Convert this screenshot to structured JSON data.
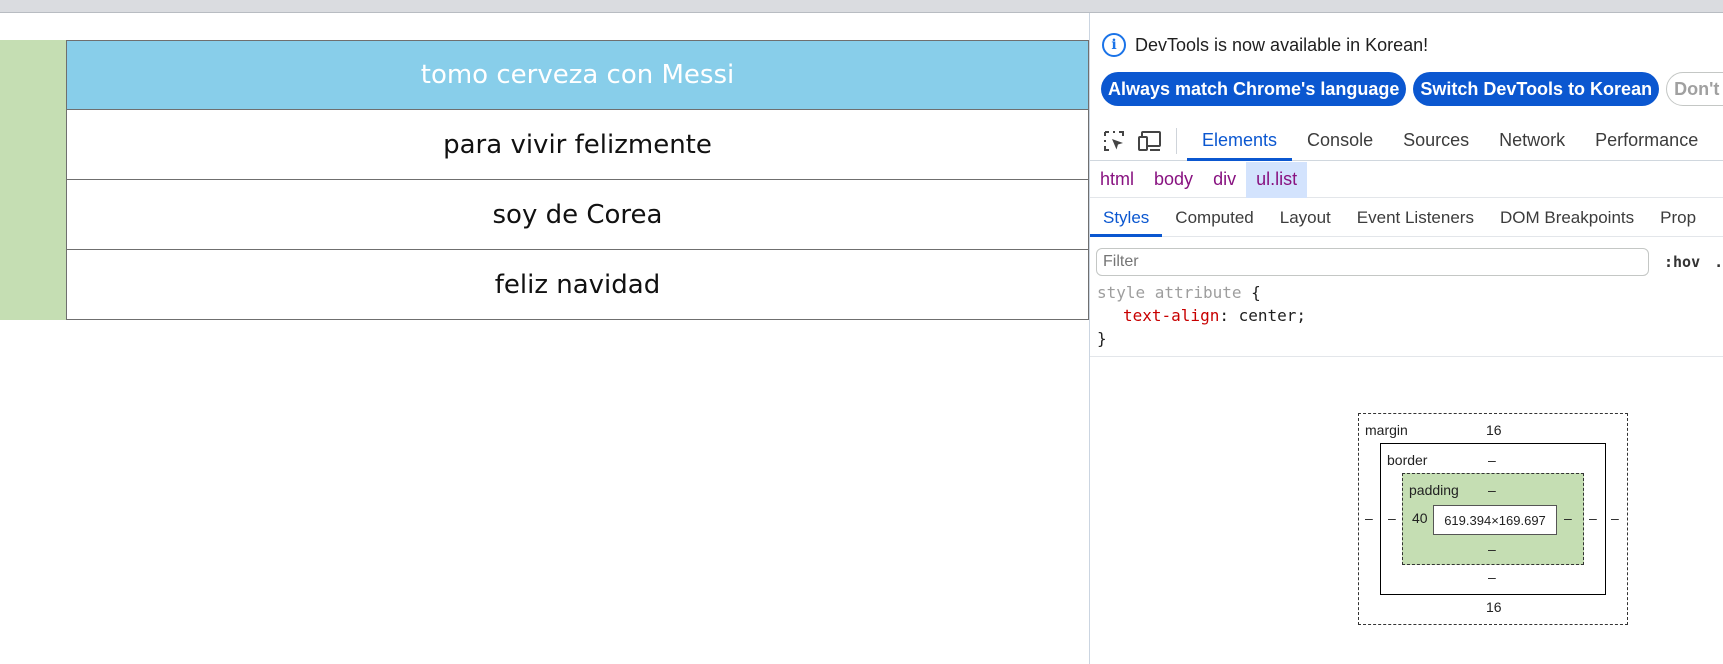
{
  "page": {
    "list_items": [
      "tomo cerveza con Messi",
      "para vivir felizmente",
      "soy de Corea",
      "feliz navidad"
    ]
  },
  "devtools": {
    "notice": "DevTools is now available in Korean!",
    "buttons": {
      "match": "Always match Chrome's language",
      "switch": "Switch DevTools to Korean",
      "dont_show": "Don't show"
    },
    "tabs": [
      "Elements",
      "Console",
      "Sources",
      "Network",
      "Performance"
    ],
    "breadcrumbs": [
      "html",
      "body",
      "div",
      "ul.list"
    ],
    "subtabs": [
      "Styles",
      "Computed",
      "Layout",
      "Event Listeners",
      "DOM Breakpoints",
      "Prop"
    ],
    "filter_placeholder": "Filter",
    "hov": ":hov",
    "cls": ".",
    "rule": {
      "selector": "style attribute",
      "open": "{",
      "prop_name": "text-align",
      "prop_value": "center;",
      "close": "}"
    },
    "box_model": {
      "margin_label": "margin",
      "margin_top": "16",
      "margin_bottom": "16",
      "margin_left": "–",
      "margin_right": "–",
      "border_label": "border",
      "border_top": "–",
      "border_bottom": "–",
      "border_left": "–",
      "border_right": "–",
      "padding_label": "padding",
      "padding_top": "–",
      "padding_bottom": "–",
      "padding_left": "40",
      "padding_right": "–",
      "content_size": "619.394×169.697"
    },
    "colors": {
      "accent": "#0b57d0",
      "list_active_bg": "#88ceea",
      "padding_highlight": "#c5deb3"
    }
  }
}
